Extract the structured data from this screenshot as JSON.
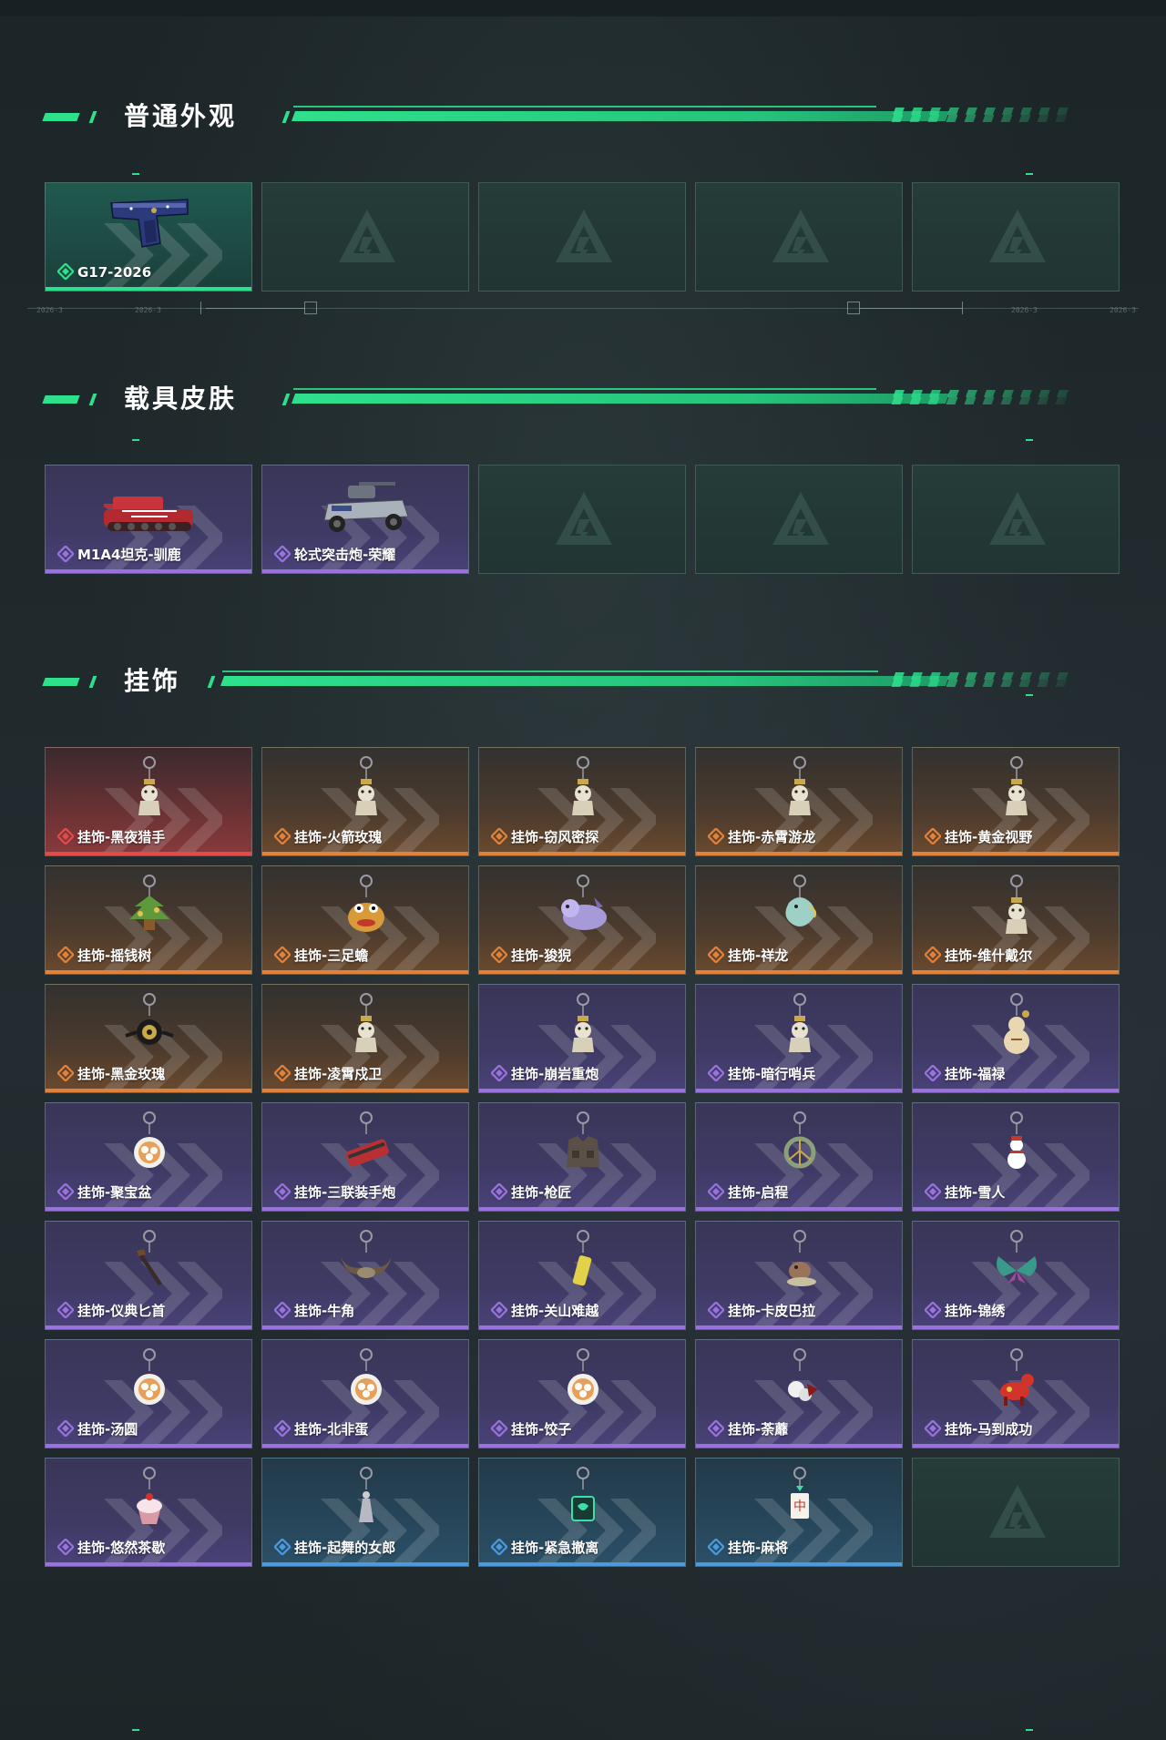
{
  "sections": [
    {
      "title": "普通外观"
    },
    {
      "title": "载具皮肤"
    },
    {
      "title": "挂饰"
    }
  ],
  "colors": {
    "accent": "#2ee08c",
    "rarity_green": "#2ee08c",
    "rarity_purple": "#9a72e0",
    "rarity_orange": "#e2823a",
    "rarity_red": "#e34a4a",
    "rarity_blue": "#4a9ae0"
  },
  "timeline_labels": [
    "2026-3",
    "2026-3",
    "2026-3",
    "2026-3"
  ],
  "cards": {
    "appearance": [
      {
        "label": "G17-2026",
        "rarity": "green",
        "icon": "pistol-icon"
      },
      {
        "label": "",
        "rarity": "empty"
      },
      {
        "label": "",
        "rarity": "empty"
      },
      {
        "label": "",
        "rarity": "empty"
      },
      {
        "label": "",
        "rarity": "empty"
      }
    ],
    "vehicles": [
      {
        "label": "M1A4坦克-驯鹿",
        "rarity": "purple",
        "icon": "tank-icon"
      },
      {
        "label": "轮式突击炮-荣耀",
        "rarity": "purple",
        "icon": "armored-car-icon"
      },
      {
        "label": "",
        "rarity": "empty"
      },
      {
        "label": "",
        "rarity": "empty"
      },
      {
        "label": "",
        "rarity": "empty"
      }
    ],
    "charms": [
      {
        "label": "挂饰-黑夜猎手",
        "rarity": "red",
        "icon": "charm-figure-icon"
      },
      {
        "label": "挂饰-火箭玫瑰",
        "rarity": "orange",
        "icon": "charm-figure-icon"
      },
      {
        "label": "挂饰-窃风密探",
        "rarity": "orange",
        "icon": "charm-figure-icon"
      },
      {
        "label": "挂饰-赤霄游龙",
        "rarity": "orange",
        "icon": "charm-figure-icon"
      },
      {
        "label": "挂饰-黄金视野",
        "rarity": "orange",
        "icon": "charm-figure-icon"
      },
      {
        "label": "挂饰-摇钱树",
        "rarity": "orange",
        "icon": "charm-tree-icon"
      },
      {
        "label": "挂饰-三足蟾",
        "rarity": "orange",
        "icon": "charm-toad-icon"
      },
      {
        "label": "挂饰-狻猊",
        "rarity": "orange",
        "icon": "charm-beast-icon"
      },
      {
        "label": "挂饰-祥龙",
        "rarity": "orange",
        "icon": "charm-dragon-icon"
      },
      {
        "label": "挂饰-维什戴尔",
        "rarity": "orange",
        "icon": "charm-figure-icon"
      },
      {
        "label": "挂饰-黑金玫瑰",
        "rarity": "orange",
        "icon": "charm-rose-icon"
      },
      {
        "label": "挂饰-凌霄戍卫",
        "rarity": "orange",
        "icon": "charm-figure-icon"
      },
      {
        "label": "挂饰-崩岩重炮",
        "rarity": "purple",
        "icon": "charm-figure-icon"
      },
      {
        "label": "挂饰-暗行哨兵",
        "rarity": "purple",
        "icon": "charm-figure-icon"
      },
      {
        "label": "挂饰-福禄",
        "rarity": "purple",
        "icon": "charm-gourd-icon"
      },
      {
        "label": "挂饰-聚宝盆",
        "rarity": "purple",
        "icon": "charm-bowl-icon"
      },
      {
        "label": "挂饰-三联装手炮",
        "rarity": "purple",
        "icon": "charm-launcher-icon"
      },
      {
        "label": "挂饰-枪匠",
        "rarity": "purple",
        "icon": "charm-vest-icon"
      },
      {
        "label": "挂饰-启程",
        "rarity": "purple",
        "icon": "charm-ring-icon"
      },
      {
        "label": "挂饰-雪人",
        "rarity": "purple",
        "icon": "charm-snowman-icon"
      },
      {
        "label": "挂饰-仪典匕首",
        "rarity": "purple",
        "icon": "charm-dagger-icon"
      },
      {
        "label": "挂饰-牛角",
        "rarity": "purple",
        "icon": "charm-horns-icon"
      },
      {
        "label": "挂饰-关山难越",
        "rarity": "purple",
        "icon": "charm-scroll-icon"
      },
      {
        "label": "挂饰-卡皮巴拉",
        "rarity": "purple",
        "icon": "charm-capybara-icon"
      },
      {
        "label": "挂饰-锦绣",
        "rarity": "purple",
        "icon": "charm-butterfly-icon"
      },
      {
        "label": "挂饰-汤圆",
        "rarity": "purple",
        "icon": "charm-bowl-icon"
      },
      {
        "label": "挂饰-北非蛋",
        "rarity": "purple",
        "icon": "charm-bowl-icon"
      },
      {
        "label": "挂饰-饺子",
        "rarity": "purple",
        "icon": "charm-bowl-icon"
      },
      {
        "label": "挂饰-荼蘼",
        "rarity": "purple",
        "icon": "charm-flower-icon"
      },
      {
        "label": "挂饰-马到成功",
        "rarity": "purple",
        "icon": "charm-horse-icon"
      },
      {
        "label": "挂饰-悠然茶歇",
        "rarity": "purple",
        "icon": "charm-cupcake-icon"
      },
      {
        "label": "挂饰-起舞的女郎",
        "rarity": "blue",
        "icon": "charm-dancer-icon"
      },
      {
        "label": "挂饰-紧急撤离",
        "rarity": "blue",
        "icon": "charm-box-icon"
      },
      {
        "label": "挂饰-麻将",
        "rarity": "blue",
        "icon": "charm-mahjong-icon"
      },
      {
        "label": "",
        "rarity": "empty"
      }
    ]
  }
}
